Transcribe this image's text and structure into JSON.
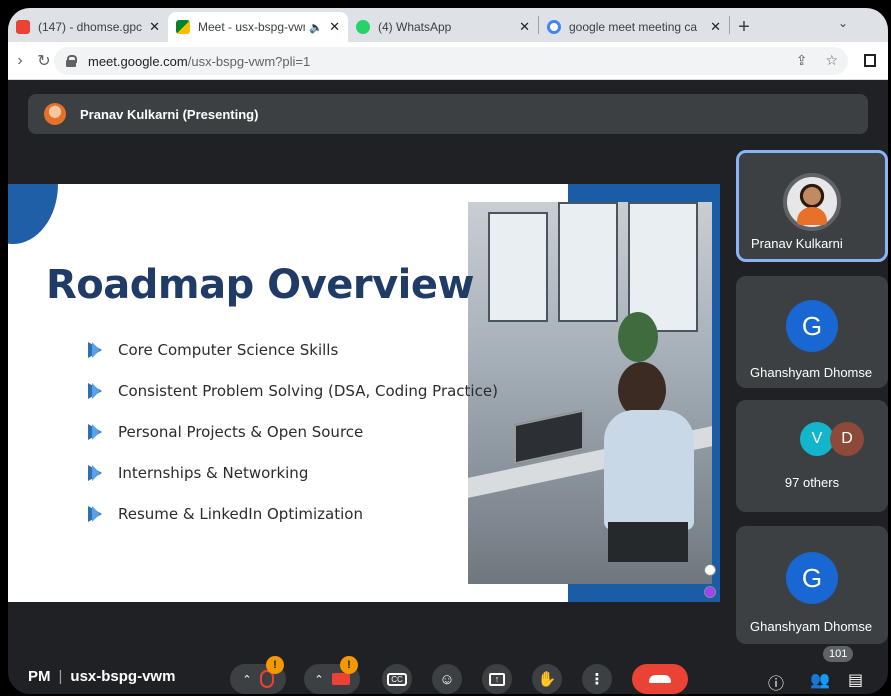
{
  "browser": {
    "tabs": [
      {
        "title": "(147) - dhomse.gpc",
        "icon": "gmail-icon",
        "active": false
      },
      {
        "title": "Meet - usx-bspg-vwm",
        "icon": "meet-icon",
        "active": true,
        "audio": "🔈"
      },
      {
        "title": "(4) WhatsApp",
        "icon": "whatsapp-icon",
        "active": false
      },
      {
        "title": "google meet meeting ca",
        "icon": "google-icon",
        "active": false
      }
    ],
    "url_host": "meet.google.com",
    "url_path": "/usx-bspg-vwm?pli=1"
  },
  "meet": {
    "presenter_label": "Pranav Kulkarni (Presenting)",
    "slide": {
      "title": "Roadmap Overview",
      "bullets": [
        "Core Computer Science Skills",
        "Consistent Problem Solving (DSA, Coding Practice)",
        "Personal Projects & Open Source",
        "Internships & Networking",
        "Resume & LinkedIn Optimization"
      ]
    },
    "participants": {
      "pranav": "Pranav Kulkarni",
      "ghanshyam_initial": "G",
      "ghanshyam": "Ghanshyam Dhomse",
      "others_initials": [
        "V",
        "D"
      ],
      "others_label": "97 others",
      "ghanshyam2_initial": "G",
      "ghanshyam2": "Ghanshyam Dhomse"
    },
    "bottom": {
      "time_suffix": "PM",
      "separator": "|",
      "meeting_code": "usx-bspg-vwm",
      "mic_badge": "!",
      "cam_badge": "!",
      "people_count": "101"
    }
  },
  "colors": {
    "accent_blue": "#1967d2",
    "slide_title": "#1f3b66",
    "end_call": "#ea4335",
    "warn": "#f29900"
  }
}
